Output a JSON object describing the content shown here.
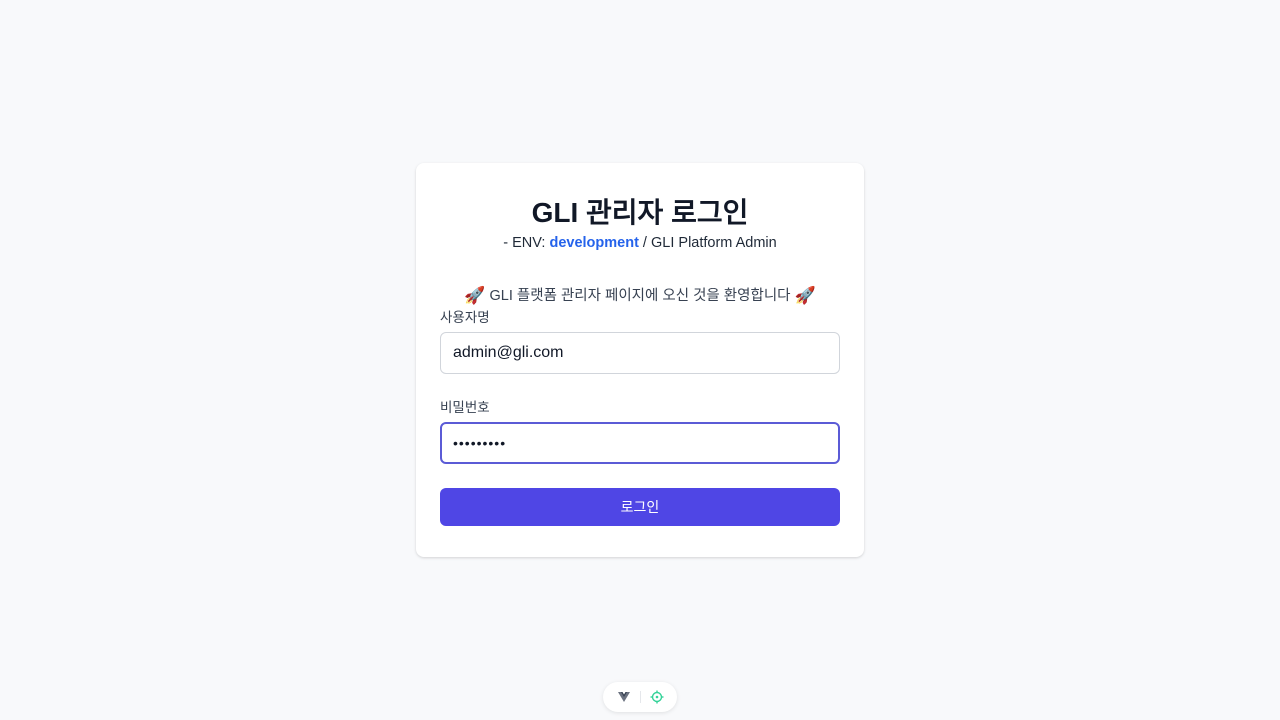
{
  "login": {
    "title": "GLI 관리자 로그인",
    "subtitle_prefix": "- ENV: ",
    "env": "development",
    "subtitle_suffix": " / GLI Platform Admin",
    "welcome_left_icon": "rocket-icon",
    "welcome_text": " GLI 플랫폼 관리자 페이지에 오신 것을 환영합니다 ",
    "welcome_right_icon": "rocket-icon",
    "username_label": "사용자명",
    "username_value": "admin@gli.com",
    "password_label": "비밀번호",
    "password_value": "•••••••••",
    "login_button": "로그인"
  },
  "devtools": {
    "icons": [
      "vue-devtools-icon",
      "inspector-target-icon"
    ]
  },
  "colors": {
    "background": "#f8f9fb",
    "accent": "#4f46e5",
    "env_link": "#2563eb",
    "focus_border": "#5b5bd6"
  }
}
